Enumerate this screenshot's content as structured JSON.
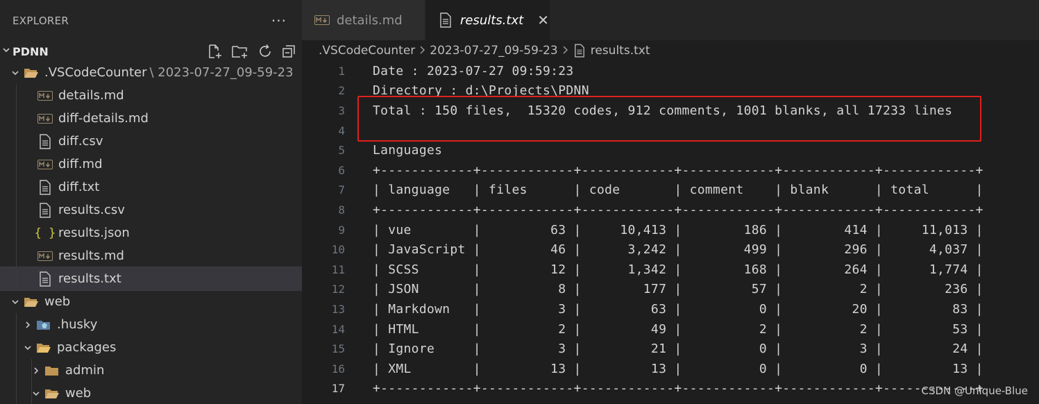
{
  "sidebar": {
    "title": "EXPLORER",
    "more": "···",
    "section_label": "PDNN",
    "tree": [
      {
        "label": ".VSCodeCounter",
        "suffix": "\\ 2023-07-27_09-59-23",
        "indent": 0,
        "twisty": "down",
        "icon": "folder-open-icon"
      },
      {
        "label": "details.md",
        "indent": 1,
        "icon": "markdown-icon"
      },
      {
        "label": "diff-details.md",
        "indent": 1,
        "icon": "markdown-icon"
      },
      {
        "label": "diff.csv",
        "indent": 1,
        "icon": "file-icon"
      },
      {
        "label": "diff.md",
        "indent": 1,
        "icon": "markdown-icon"
      },
      {
        "label": "diff.txt",
        "indent": 1,
        "icon": "file-icon"
      },
      {
        "label": "results.csv",
        "indent": 1,
        "icon": "file-icon"
      },
      {
        "label": "results.json",
        "indent": 1,
        "icon": "json-icon"
      },
      {
        "label": "results.md",
        "indent": 1,
        "icon": "markdown-icon"
      },
      {
        "label": "results.txt",
        "indent": 1,
        "icon": "file-icon",
        "selected": true
      },
      {
        "label": "web",
        "indent": 0,
        "twisty": "down",
        "icon": "folder-open-icon"
      },
      {
        "label": ".husky",
        "indent": 1,
        "twisty": "right",
        "icon": "husky-folder-icon"
      },
      {
        "label": "packages",
        "indent": 1,
        "twisty": "down",
        "icon": "folder-open-icon"
      },
      {
        "label": "admin",
        "indent": 2,
        "twisty": "right",
        "icon": "folder-icon"
      },
      {
        "label": "web",
        "indent": 2,
        "twisty": "down",
        "icon": "folder-open-icon"
      }
    ]
  },
  "tabs": [
    {
      "label": "details.md",
      "icon": "markdown-icon",
      "active": false
    },
    {
      "label": "results.txt",
      "icon": "file-icon",
      "active": true,
      "close": "✕"
    }
  ],
  "breadcrumb": [
    ".VSCodeCounter",
    "2023-07-27_09-59-23",
    "results.txt"
  ],
  "lines": [
    {
      "n": "1",
      "text": "Date : 2023-07-27 09:59:23"
    },
    {
      "n": "2",
      "text": "Directory : d:\\Projects\\PDNN"
    },
    {
      "n": "3",
      "text": "Total : 150 files,  15320 codes, 912 comments, 1001 blanks, all 17233 lines"
    },
    {
      "n": "4",
      "text": ""
    },
    {
      "n": "5",
      "text": "Languages"
    },
    {
      "n": "6",
      "text": "+------------+------------+------------+------------+------------+------------+"
    },
    {
      "n": "7",
      "text": "| language   | files      | code       | comment    | blank      | total      |"
    },
    {
      "n": "8",
      "text": "+------------+------------+------------+------------+------------+------------+"
    },
    {
      "n": "9",
      "text": "| vue        |         63 |     10,413 |        186 |        414 |     11,013 |"
    },
    {
      "n": "10",
      "text": "| JavaScript |         46 |      3,242 |        499 |        296 |      4,037 |"
    },
    {
      "n": "11",
      "text": "| SCSS       |         12 |      1,342 |        168 |        264 |      1,774 |"
    },
    {
      "n": "12",
      "text": "| JSON       |          8 |        177 |         57 |          2 |        236 |"
    },
    {
      "n": "13",
      "text": "| Markdown   |          3 |         63 |          0 |         20 |         83 |"
    },
    {
      "n": "14",
      "text": "| HTML       |          2 |         49 |          2 |          2 |         53 |"
    },
    {
      "n": "15",
      "text": "| Ignore     |          3 |         21 |          0 |          3 |         24 |"
    },
    {
      "n": "16",
      "text": "| XML        |         13 |         13 |          0 |          0 |         13 |"
    },
    {
      "n": "17",
      "text": "+------------+------------+------------+------------+------------+------------+",
      "current": true
    }
  ],
  "watermark": "CSDN @Unique-Blue",
  "colors": {
    "highlight": "#e0201c",
    "selection": "#37373d",
    "json_brace": "#cbcb41",
    "folder": "#d7b46a"
  }
}
